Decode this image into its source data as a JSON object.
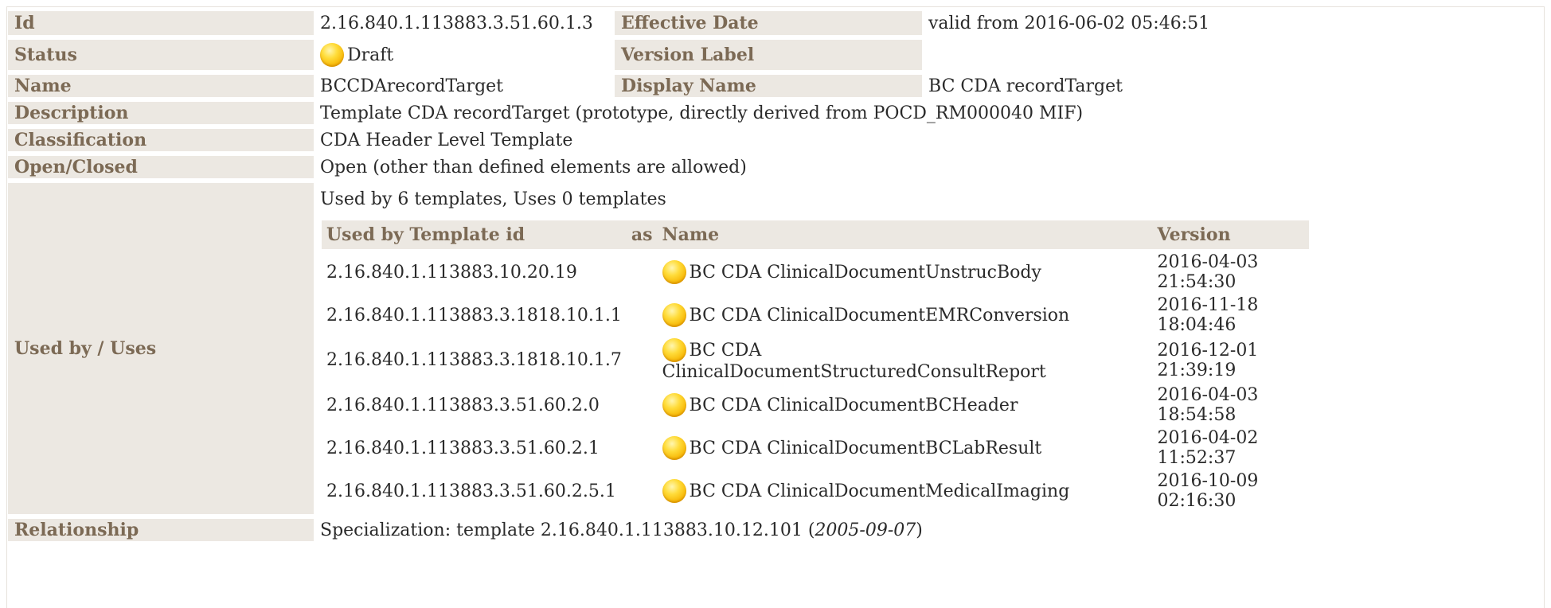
{
  "rows": {
    "id": {
      "label": "Id",
      "value": "2.16.840.1.113883.3.51.60.1.3"
    },
    "effective_date": {
      "label": "Effective Date",
      "value": "valid from 2016-06-02 05:46:51"
    },
    "status": {
      "label": "Status",
      "value": "Draft",
      "icon": "status-draft-icon"
    },
    "version_label": {
      "label": "Version Label",
      "value": ""
    },
    "name": {
      "label": "Name",
      "value": "BCCDArecordTarget"
    },
    "display_name": {
      "label": "Display Name",
      "value": "BC CDA recordTarget"
    },
    "description": {
      "label": "Description",
      "value": "Template CDA recordTarget (prototype, directly derived from POCD_RM000040 MIF)"
    },
    "classification": {
      "label": "Classification",
      "value": "CDA Header Level Template"
    },
    "open_closed": {
      "label": "Open/Closed",
      "value": "Open (other than defined elements are allowed)"
    },
    "used_by": {
      "label": "Used by / Uses",
      "summary": "Used by 6 templates, Uses 0 templates"
    },
    "relationship": {
      "label": "Relationship",
      "prefix": "Specialization: template 2.16.840.1.113883.10.12.101 (",
      "date": "2005-09-07",
      "suffix": ")"
    }
  },
  "used_by_table": {
    "headers": {
      "template_id": "Used by Template id",
      "as": "as",
      "name": "Name",
      "version": "Version"
    },
    "rows": [
      {
        "id": "2.16.840.1.113883.10.20.19",
        "name": "BC CDA ClinicalDocumentUnstrucBody",
        "version": "2016-04-03 21:54:30"
      },
      {
        "id": "2.16.840.1.113883.3.1818.10.1.1",
        "name": "BC CDA ClinicalDocumentEMRConversion",
        "version": "2016-11-18 18:04:46"
      },
      {
        "id": "2.16.840.1.113883.3.1818.10.1.7",
        "name": "BC CDA ClinicalDocumentStructuredConsultReport",
        "version": "2016-12-01 21:39:19"
      },
      {
        "id": "2.16.840.1.113883.3.51.60.2.0",
        "name": "BC CDA ClinicalDocumentBCHeader",
        "version": "2016-04-03 18:54:58"
      },
      {
        "id": "2.16.840.1.113883.3.51.60.2.1",
        "name": "BC CDA ClinicalDocumentBCLabResult",
        "version": "2016-04-02 11:52:37"
      },
      {
        "id": "2.16.840.1.113883.3.51.60.2.5.1",
        "name": "BC CDA ClinicalDocumentMedicalImaging",
        "version": "2016-10-09 02:16:30"
      }
    ]
  },
  "colors": {
    "label_bg": "#ece8e2",
    "label_text": "#7c6a55",
    "status_draft": "#f6b300"
  }
}
